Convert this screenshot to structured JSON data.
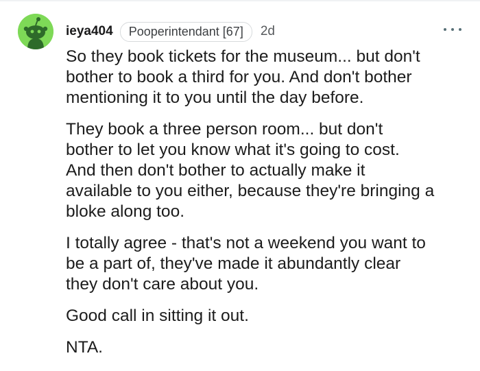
{
  "comment": {
    "author": "ieya404",
    "flair": "Pooperintendant [67]",
    "age": "2d",
    "paragraphs": [
      "So they book tickets for the museum... but don't\nbother to book a third for you. And don't bother\nmentioning it to you until the day before.",
      "They book a three person room... but don't\nbother to let you know what it's going to cost.\nAnd then don't bother to actually make it\navailable to you either, because they're bringing a\nbloke along too.",
      "I totally agree - that's not a weekend you want to\nbe a part of, they've made it abundantly clear\nthey don't care about you.",
      "Good call in sitting it out.",
      "NTA."
    ]
  },
  "icons": {
    "avatar": "reddit-snoo-avatar-icon",
    "more": "more-options-icon"
  },
  "colors": {
    "avatar_bg": "#7ed957",
    "text": "#1a1a1b",
    "flair_border": "#d7dadc"
  }
}
